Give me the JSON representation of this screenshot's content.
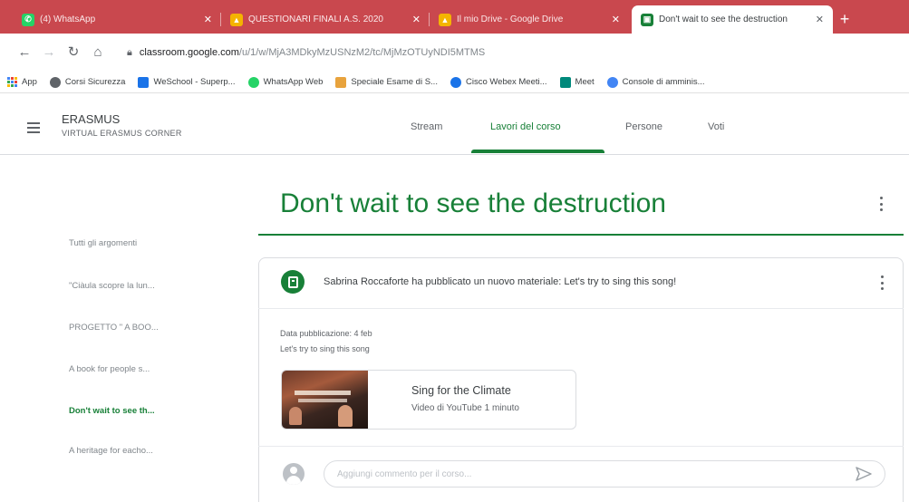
{
  "browser": {
    "tabs": [
      {
        "title": "(4) WhatsApp",
        "color": "#25d366",
        "glyph": "✆"
      },
      {
        "title": "QUESTIONARI FINALI A.S. 2020",
        "color": "#f4b400",
        "glyph": "▲"
      },
      {
        "title": "Il mio Drive - Google Drive",
        "color": "#f4b400",
        "glyph": "▲"
      },
      {
        "title": "Don't wait to see the destruction",
        "color": "#188038",
        "glyph": "▣"
      }
    ],
    "new_tab": "+",
    "url_host": "classroom.google.com",
    "url_path": "/u/1/w/MjA3MDkyMzUSNzM2/tc/MjMzOTUyNDI5MTMS",
    "bookmarks": [
      {
        "label": "App",
        "color": "#4285f4"
      },
      {
        "label": "Corsi Sicurezza",
        "color": "#5f6368"
      },
      {
        "label": "WeSchool - Superp...",
        "color": "#1a73e8"
      },
      {
        "label": "WhatsApp Web",
        "color": "#25d366"
      },
      {
        "label": "Speciale Esame di S...",
        "color": "#e8a33d"
      },
      {
        "label": "Cisco Webex Meeti...",
        "color": "#1a73e8"
      },
      {
        "label": "Meet",
        "color": "#00897b"
      },
      {
        "label": "Console di amminis...",
        "color": "#4285f4"
      }
    ]
  },
  "classroom": {
    "class_name": "ERASMUS",
    "class_section": "VIRTUAL ERASMUS CORNER",
    "nav": [
      "Stream",
      "Lavori del corso",
      "Persone",
      "Voti"
    ],
    "accent": "#188038"
  },
  "sidebar": {
    "topics": [
      "Tutti gli argomenti",
      "\"Ciàula scopre la lun...",
      "PROGETTO \" A BOO...",
      "A book for people s...",
      "Don't wait to see th...",
      "A heritage for eacho..."
    ]
  },
  "main": {
    "title": "Don't wait to see the destruction",
    "post": {
      "text": "Sabrina Roccaforte ha pubblicato un nuovo materiale: Let's try to sing this song!",
      "date": "Data pubblicazione: 4 feb",
      "description": "Let's try to sing this song",
      "attachment": {
        "title": "Sing for the Climate",
        "subtitle": "Video di YouTube   1 minuto"
      },
      "comment_placeholder": "Aggiungi commento per il corso..."
    }
  }
}
